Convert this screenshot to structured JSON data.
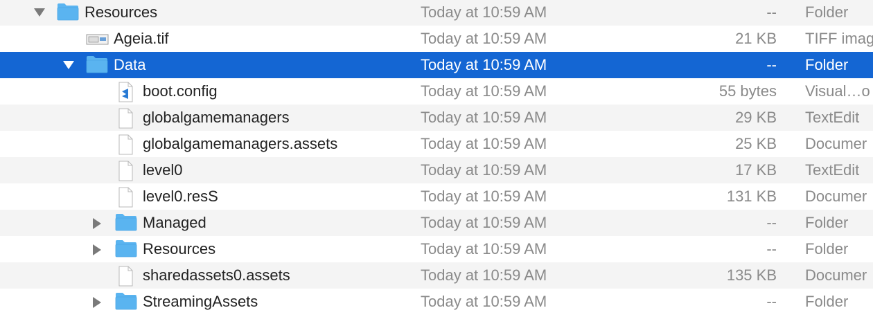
{
  "colors": {
    "selection": "#1466d3",
    "folder": "#5ab4f0",
    "meta_text": "#8a8a8a",
    "stripe": "#f4f4f4"
  },
  "rows": [
    {
      "name": "Resources",
      "date": "Today at 10:59 AM",
      "size": "--",
      "kind": "Folder",
      "depth": 0,
      "disclosure": "expanded",
      "icon": "folder-icon",
      "selected": false
    },
    {
      "name": "Ageia.tif",
      "date": "Today at 10:59 AM",
      "size": "21 KB",
      "kind": "TIFF imag",
      "depth": 1,
      "disclosure": "none",
      "icon": "tiff-image-icon",
      "selected": false
    },
    {
      "name": "Data",
      "date": "Today at 10:59 AM",
      "size": "--",
      "kind": "Folder",
      "depth": 1,
      "disclosure": "expanded",
      "icon": "folder-icon",
      "selected": true
    },
    {
      "name": "boot.config",
      "date": "Today at 10:59 AM",
      "size": "55 bytes",
      "kind": "Visual…o",
      "depth": 2,
      "disclosure": "none",
      "icon": "vscode-file-icon",
      "selected": false
    },
    {
      "name": "globalgamemanagers",
      "date": "Today at 10:59 AM",
      "size": "29 KB",
      "kind": "TextEdit",
      "depth": 2,
      "disclosure": "none",
      "icon": "document-icon",
      "selected": false
    },
    {
      "name": "globalgamemanagers.assets",
      "date": "Today at 10:59 AM",
      "size": "25 KB",
      "kind": "Documer",
      "depth": 2,
      "disclosure": "none",
      "icon": "document-icon",
      "selected": false
    },
    {
      "name": "level0",
      "date": "Today at 10:59 AM",
      "size": "17 KB",
      "kind": "TextEdit",
      "depth": 2,
      "disclosure": "none",
      "icon": "document-icon",
      "selected": false
    },
    {
      "name": "level0.resS",
      "date": "Today at 10:59 AM",
      "size": "131 KB",
      "kind": "Documer",
      "depth": 2,
      "disclosure": "none",
      "icon": "document-icon",
      "selected": false
    },
    {
      "name": "Managed",
      "date": "Today at 10:59 AM",
      "size": "--",
      "kind": "Folder",
      "depth": 2,
      "disclosure": "collapsed",
      "icon": "folder-icon",
      "selected": false
    },
    {
      "name": "Resources",
      "date": "Today at 10:59 AM",
      "size": "--",
      "kind": "Folder",
      "depth": 2,
      "disclosure": "collapsed",
      "icon": "folder-icon",
      "selected": false
    },
    {
      "name": "sharedassets0.assets",
      "date": "Today at 10:59 AM",
      "size": "135 KB",
      "kind": "Documer",
      "depth": 2,
      "disclosure": "none",
      "icon": "document-icon",
      "selected": false
    },
    {
      "name": "StreamingAssets",
      "date": "Today at 10:59 AM",
      "size": "--",
      "kind": "Folder",
      "depth": 2,
      "disclosure": "collapsed",
      "icon": "folder-icon",
      "selected": false
    }
  ]
}
